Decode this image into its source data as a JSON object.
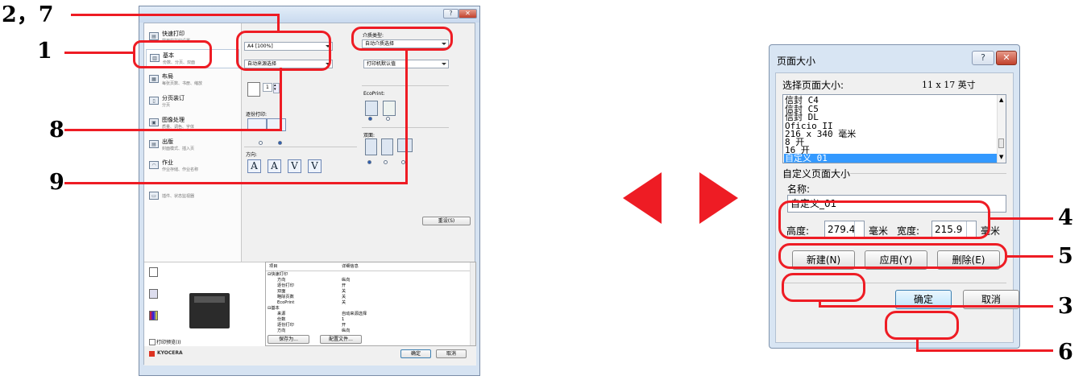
{
  "callouts": {
    "left": [
      "2，7",
      "1",
      "8",
      "9"
    ],
    "right": [
      "4",
      "5",
      "3",
      "6"
    ],
    "color": "#ee1c24"
  },
  "nav_arrows": {
    "prev": "prev-arrow",
    "next": "next-arrow",
    "color": "#ee1c24"
  },
  "driver": {
    "nav": [
      {
        "title": "快速打印",
        "sub": "常用的打印设置"
      },
      {
        "title": "基本",
        "sub": "份数、分页、双面"
      },
      {
        "title": "布局",
        "sub": "每张页数、书册、缩放"
      },
      {
        "title": "分页装订",
        "sub": "分页"
      },
      {
        "title": "图像处理",
        "sub": "质量、调色、字体"
      },
      {
        "title": "出版",
        "sub": "封面模式、插入页"
      },
      {
        "title": "作业",
        "sub": "作业存储、作业名称"
      },
      {
        "title": "",
        "sub": ""
      },
      {
        "title": "",
        "sub": "插件、状态监视器"
      }
    ],
    "paper_size": "A4  [100%]",
    "source": "自动来源选择",
    "media_type_label": "介质类型:",
    "media_type": "自动介质选择",
    "destination": "打印机默认值",
    "copies": "1",
    "collate_label": "逐份打印:",
    "ecoprint_label": "EcoPrint:",
    "duplex_label": "双面:",
    "orientation_label": "方向:",
    "orientation_glyphs": [
      "A",
      "A",
      "V",
      "V"
    ],
    "reset": "重设(S)",
    "summary_headers": [
      "项目",
      "详细信息"
    ],
    "summary_rows": [
      [
        "⊟快速打印",
        ""
      ],
      [
        "方向",
        "纵向"
      ],
      [
        "逐份打印",
        "开"
      ],
      [
        "双面",
        "关"
      ],
      [
        "略除页数",
        "关"
      ],
      [
        "EcoPrint",
        "关"
      ],
      [
        "⊟基本",
        ""
      ],
      [
        "来源",
        "自动来源选择"
      ],
      [
        "份数",
        "1"
      ],
      [
        "逐份打印",
        "开"
      ],
      [
        "方向",
        "纵向"
      ]
    ],
    "save_as": "保存为...",
    "profile": "配置文件...",
    "print_preview": "打印预览(I)",
    "brand": "KYOCERA",
    "ok": "确定",
    "cancel": "取消",
    "help_glyph": "?",
    "close_glyph": "✕"
  },
  "dialog": {
    "title": "页面大小",
    "help_glyph": "?",
    "close_glyph": "✕",
    "select_label": "选择页面大小:",
    "size_display": "11 x 17 英寸",
    "list": [
      "信封 C4",
      "信封 C5",
      "信封 DL",
      "Oficio II",
      "216 x 340 毫米",
      "8 开",
      "16 开",
      "自定义_01"
    ],
    "selected_index": 7,
    "custom_group": "自定义页面大小",
    "name_label": "名称:",
    "name_value": "自定义_01",
    "height_label": "高度:",
    "height_value": "279.4",
    "height_unit": "毫米",
    "width_label": "宽度:",
    "width_value": "215.9",
    "width_unit": "毫米",
    "new_btn": "新建(N)",
    "apply_btn": "应用(Y)",
    "delete_btn": "删除(E)",
    "ok_btn": "确定",
    "cancel_btn": "取消"
  }
}
